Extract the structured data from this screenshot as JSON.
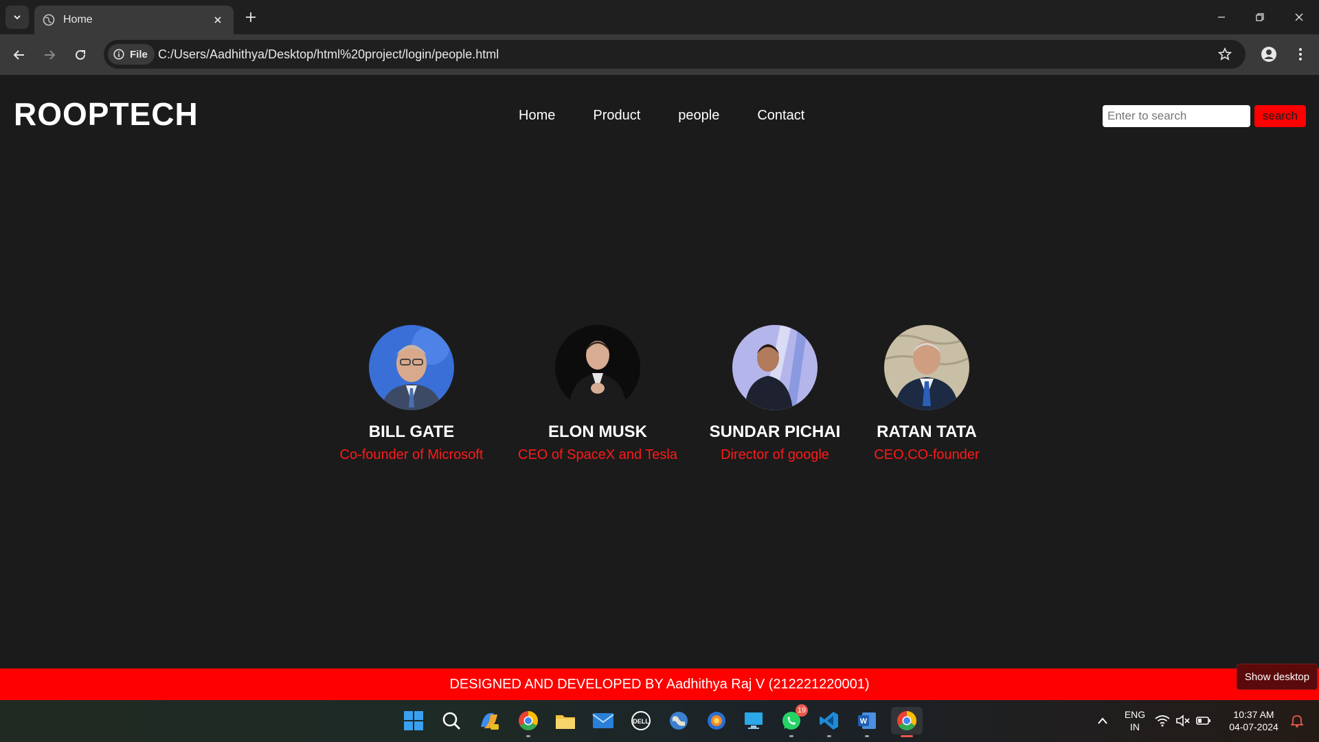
{
  "browser": {
    "tab_title": "Home",
    "site_chip": "File",
    "url": "C:/Users/Aadhithya/Desktop/html%20project/login/people.html"
  },
  "page": {
    "brand": "ROOPTECH",
    "nav": [
      "Home",
      "Product",
      "people",
      "Contact"
    ],
    "search": {
      "placeholder": "Enter to search",
      "button": "search"
    },
    "people": [
      {
        "name": "BILL GATE",
        "role": "Co-founder of Microsoft"
      },
      {
        "name": "ELON MUSK",
        "role": "CEO of SpaceX and Tesla"
      },
      {
        "name": "SUNDAR PICHAI",
        "role": "Director of google"
      },
      {
        "name": "RATAN TATA",
        "role": "CEO,CO-founder"
      }
    ],
    "footer": "DESIGNED AND DEVELOPED BY Aadhithya Raj V (212221220001)"
  },
  "tooltip": "Show desktop",
  "taskbar": {
    "apps": [
      "windows-start-icon",
      "search-icon",
      "copilot-icon",
      "chrome-icon",
      "file-explorer-icon",
      "mail-icon",
      "dell-icon",
      "globe-app-icon",
      "browser-app-icon",
      "desktop-app-icon",
      "whatsapp-icon",
      "vscode-icon",
      "word-icon",
      "chrome-active-icon"
    ],
    "whatsapp_badge": "19",
    "language": "ENG",
    "region": "IN",
    "time": "10:37 AM",
    "date": "04-07-2024"
  },
  "colors": {
    "accent": "#ff0000",
    "background": "#1c1b1b",
    "role_text": "#ff1a1a"
  }
}
